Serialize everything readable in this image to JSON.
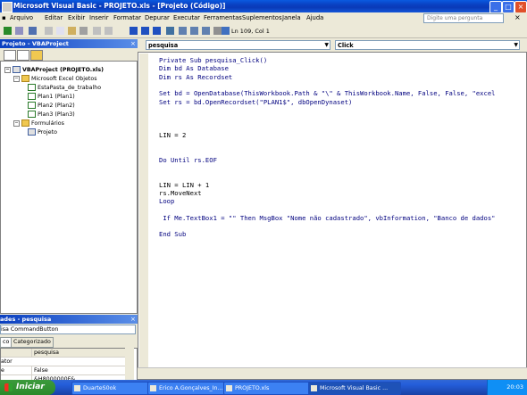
{
  "titlebar": {
    "title": "Microsoft Visual Basic - PROJETO.xls - [Projeto (Código)]"
  },
  "menu": [
    "Arquivo",
    "Editar",
    "Exibir",
    "Inserir",
    "Formatar",
    "Depurar",
    "Executar",
    "Ferramentas",
    "Suplementos",
    "Janela",
    "Ajuda"
  ],
  "ask_placeholder": "Digite uma pergunta",
  "toolbar": {
    "position": "Ln 109, Col 1"
  },
  "project": {
    "title": "Projeto - VBAProject",
    "tree": [
      {
        "label": "VBAProject (PROJETO.xls)",
        "type": "root"
      },
      {
        "label": "Microsoft Excel Objetos",
        "type": "folder"
      },
      {
        "label": "EstaPasta_de_trabalho",
        "type": "sheet"
      },
      {
        "label": "Plan1 (Plan1)",
        "type": "sheet"
      },
      {
        "label": "Plan2 (Plan2)",
        "type": "sheet"
      },
      {
        "label": "Plan3 (Plan3)",
        "type": "sheet"
      },
      {
        "label": "Formulários",
        "type": "folder"
      },
      {
        "label": "Projeto",
        "type": "form"
      }
    ]
  },
  "properties": {
    "title": "ades - pesquisa",
    "object": "isa CommandButton",
    "tabs": [
      "co",
      "Categorizado"
    ],
    "rows": [
      {
        "key": "",
        "value": "pesquisa"
      },
      {
        "key": "ator",
        "value": ""
      },
      {
        "key": "e",
        "value": "False"
      },
      {
        "key": "",
        "value": "&H8000000F&"
      }
    ]
  },
  "code": {
    "object_combo": "pesquisa",
    "procedure_combo": "Click",
    "lines": [
      "Private Sub pesquisa_Click()",
      "Dim bd As Database",
      "Dim rs As Recordset",
      "",
      "Set bd = OpenDatabase(ThisWorkbook.Path & \"\\\" & ThisWorkbook.Name, False, False, \"excel",
      "Set rs = bd.OpenRecordset(\"PLAN1$\", dbOpenDynaset)",
      "",
      "",
      "",
      "LIN = 2",
      "",
      "",
      "Do Until rs.EOF",
      "",
      "",
      "LIN = LIN + 1",
      "rs.MoveNext",
      "Loop",
      "",
      " If Me.TextBox1 = \"\" Then MsgBox \"Nome não cadastrado\", vbInformation, \"Banco de dados\"",
      "",
      "End Sub"
    ]
  },
  "taskbar": {
    "start": "Iniciar",
    "tasks": [
      "DuarteS0ok",
      "Erico A.Gonçalves_In...",
      "PROJETO.xls",
      "Microsoft Visual Basic ..."
    ],
    "clock": "20:03"
  }
}
